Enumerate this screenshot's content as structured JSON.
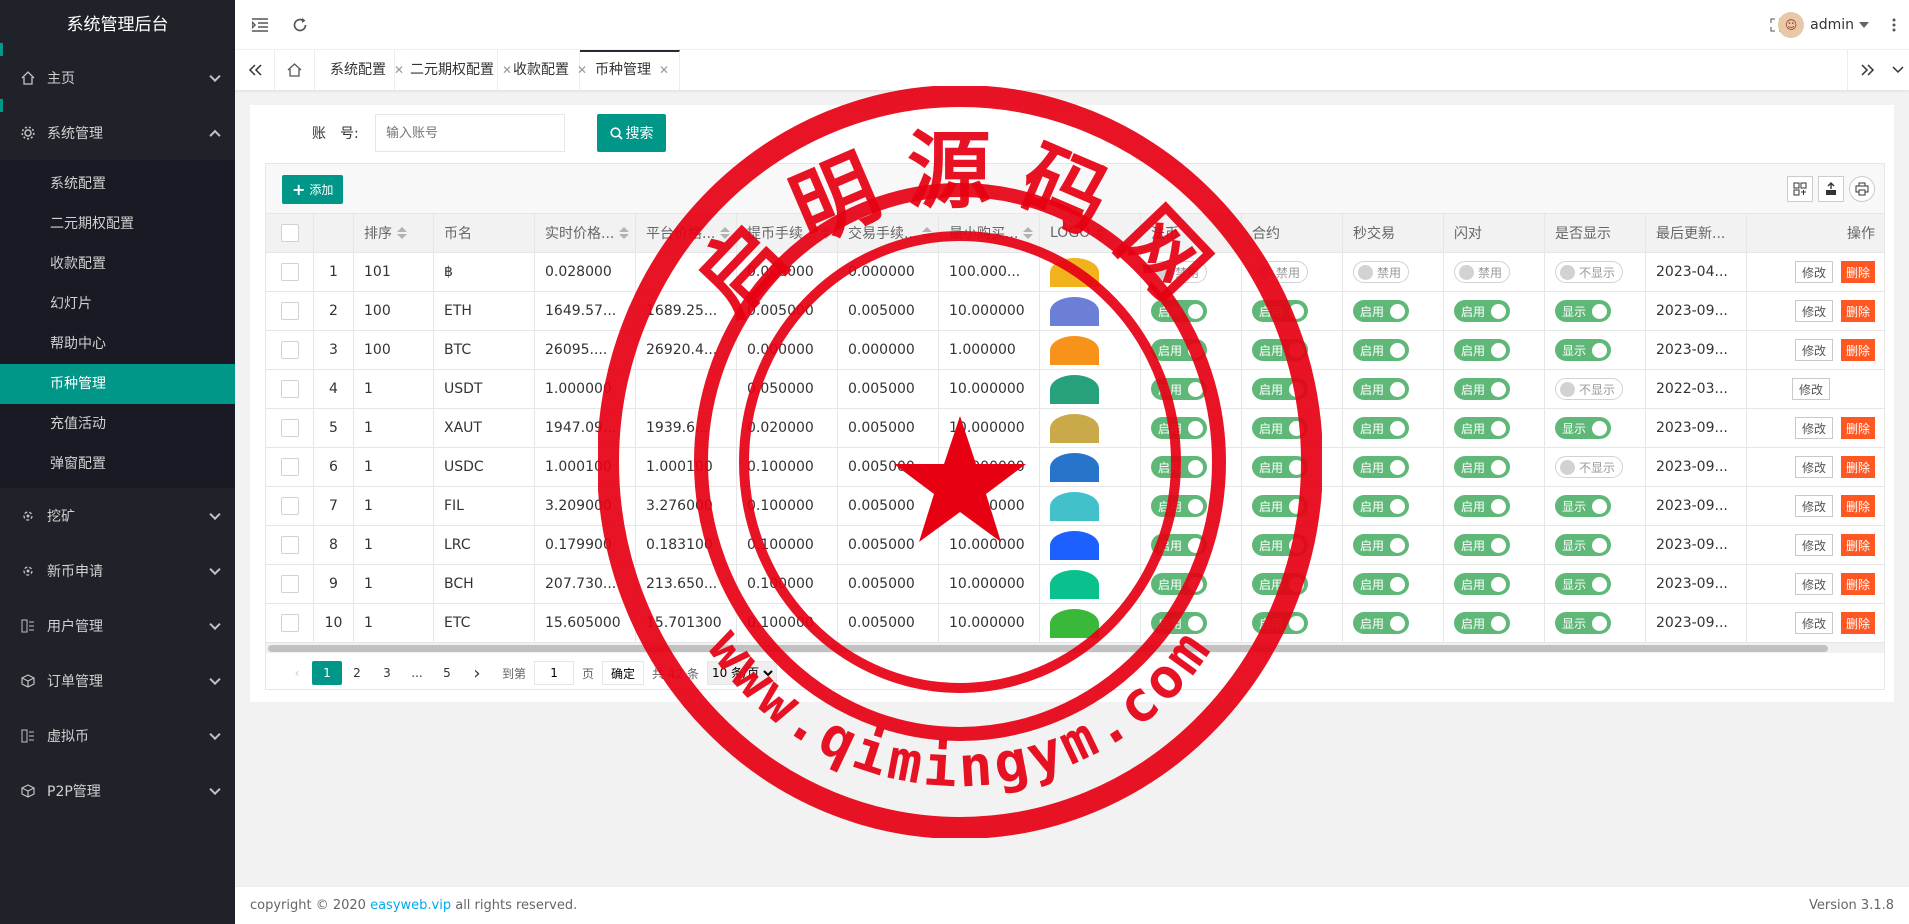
{
  "app": {
    "title": "系统管理后台"
  },
  "sidebar": {
    "items": [
      {
        "name": "home",
        "label": "主页",
        "icon": "home-icon",
        "expanded": false
      },
      {
        "name": "system",
        "label": "系统管理",
        "icon": "gear-icon",
        "expanded": true,
        "children": [
          {
            "label": "系统配置"
          },
          {
            "label": "二元期权配置"
          },
          {
            "label": "收款配置"
          },
          {
            "label": "幻灯片"
          },
          {
            "label": "帮助中心"
          },
          {
            "label": "币种管理",
            "active": true
          },
          {
            "label": "充值活动"
          },
          {
            "label": "弹窗配置"
          }
        ]
      },
      {
        "name": "mining",
        "label": "挖矿",
        "icon": "mining-icon"
      },
      {
        "name": "newcoin",
        "label": "新币申请",
        "icon": "mining-icon"
      },
      {
        "name": "users",
        "label": "用户管理",
        "icon": "list-icon"
      },
      {
        "name": "orders",
        "label": "订单管理",
        "icon": "cube-icon"
      },
      {
        "name": "virtual",
        "label": "虚拟币",
        "icon": "list-icon"
      },
      {
        "name": "p2p",
        "label": "P2P管理",
        "icon": "cube-icon"
      }
    ]
  },
  "header": {
    "user": "admin"
  },
  "tabs": [
    {
      "label": "系统配置"
    },
    {
      "label": "二元期权配置"
    },
    {
      "label": "收款配置"
    },
    {
      "label": "币种管理",
      "active": true
    }
  ],
  "search": {
    "label": "账　号:",
    "placeholder": "输入账号",
    "button": "搜索"
  },
  "toolbar": {
    "add": "添加"
  },
  "table": {
    "columns": [
      "排序",
      "币名",
      "实时价格...",
      "平台价格...",
      "提币手续...",
      "交易手续...",
      "最小购买...",
      "LOGO",
      "法币",
      "合约",
      "秒交易",
      "闪对",
      "是否显示",
      "最后更新...",
      "操作"
    ],
    "rows": [
      {
        "idx": "1",
        "order": "101",
        "coin": "฿",
        "real": "0.028000",
        "ref": "",
        "fee1": "0.000000",
        "fee2": "0.000000",
        "min": "100.000...",
        "logo": "#f2b21e",
        "fiat": false,
        "contract": false,
        "sec": false,
        "flash": false,
        "show": false,
        "time": "2023-04...",
        "del": true
      },
      {
        "idx": "2",
        "order": "100",
        "coin": "ETH",
        "real": "1649.57...",
        "ref": "1689.25...",
        "fee1": "0.005000",
        "fee2": "0.005000",
        "min": "10.000000",
        "logo": "#6b7fd7",
        "fiat": true,
        "contract": true,
        "sec": true,
        "flash": true,
        "show": true,
        "time": "2023-09...",
        "del": true
      },
      {
        "idx": "3",
        "order": "100",
        "coin": "BTC",
        "real": "26095....",
        "ref": "26920.4...",
        "fee1": "0.000000",
        "fee2": "0.000000",
        "min": "1.000000",
        "logo": "#f7931a",
        "fiat": true,
        "contract": true,
        "sec": true,
        "flash": true,
        "show": true,
        "time": "2023-09...",
        "del": true
      },
      {
        "idx": "4",
        "order": "1",
        "coin": "USDT",
        "real": "1.000000",
        "ref": "",
        "fee1": "0.050000",
        "fee2": "0.005000",
        "min": "10.000000",
        "logo": "#26a17b",
        "fiat": true,
        "contract": true,
        "sec": true,
        "flash": true,
        "show": false,
        "time": "2022-03...",
        "del": false
      },
      {
        "idx": "5",
        "order": "1",
        "coin": "XAUT",
        "real": "1947.09...",
        "ref": "1939.6...",
        "fee1": "0.020000",
        "fee2": "0.005000",
        "min": "10.000000",
        "logo": "#c9a94a",
        "fiat": true,
        "contract": true,
        "sec": true,
        "flash": true,
        "show": true,
        "time": "2023-09...",
        "del": true
      },
      {
        "idx": "6",
        "order": "1",
        "coin": "USDC",
        "real": "1.000100",
        "ref": "1.000100",
        "fee1": "0.100000",
        "fee2": "0.005000",
        "min": "10.000000",
        "logo": "#2775ca",
        "fiat": true,
        "contract": true,
        "sec": true,
        "flash": true,
        "show": false,
        "time": "2023-09...",
        "del": true
      },
      {
        "idx": "7",
        "order": "1",
        "coin": "FIL",
        "real": "3.209000",
        "ref": "3.276000",
        "fee1": "0.100000",
        "fee2": "0.005000",
        "min": "10.000000",
        "logo": "#42c1ca",
        "fiat": true,
        "contract": true,
        "sec": true,
        "flash": true,
        "show": true,
        "time": "2023-09...",
        "del": true
      },
      {
        "idx": "8",
        "order": "1",
        "coin": "LRC",
        "real": "0.179900",
        "ref": "0.183100",
        "fee1": "0.100000",
        "fee2": "0.005000",
        "min": "10.000000",
        "logo": "#1c60ff",
        "fiat": true,
        "contract": true,
        "sec": true,
        "flash": true,
        "show": true,
        "time": "2023-09...",
        "del": true
      },
      {
        "idx": "9",
        "order": "1",
        "coin": "BCH",
        "real": "207.730...",
        "ref": "213.650...",
        "fee1": "0.100000",
        "fee2": "0.005000",
        "min": "10.000000",
        "logo": "#0ac18e",
        "fiat": true,
        "contract": true,
        "sec": true,
        "flash": true,
        "show": true,
        "time": "2023-09...",
        "del": true
      },
      {
        "idx": "10",
        "order": "1",
        "coin": "ETC",
        "real": "15.605000",
        "ref": "15.701300",
        "fee1": "0.100000",
        "fee2": "0.005000",
        "min": "10.000000",
        "logo": "#3ab83a",
        "fiat": true,
        "contract": true,
        "sec": true,
        "flash": true,
        "show": true,
        "time": "2023-09...",
        "del": true
      }
    ],
    "labels": {
      "on": "启用",
      "off": "禁用",
      "show_on": "显示",
      "show_off": "不显示",
      "edit": "修改",
      "del": "删除"
    }
  },
  "pager": {
    "pages": [
      "1",
      "2",
      "3",
      "...",
      "5"
    ],
    "goto": "到第",
    "page_value": "1",
    "page_unit": "页",
    "confirm": "确定",
    "total": "共 42 条",
    "size": "10 条/页"
  },
  "footer": {
    "copy_prefix": "copyright © 2020 ",
    "link": "easyweb.vip",
    "copy_suffix": " all rights reserved.",
    "version": "Version 3.1.8"
  },
  "watermark": {
    "text_top": "启明源码网",
    "text_bottom": "www.qimingym.com",
    "color": "#e60012"
  }
}
